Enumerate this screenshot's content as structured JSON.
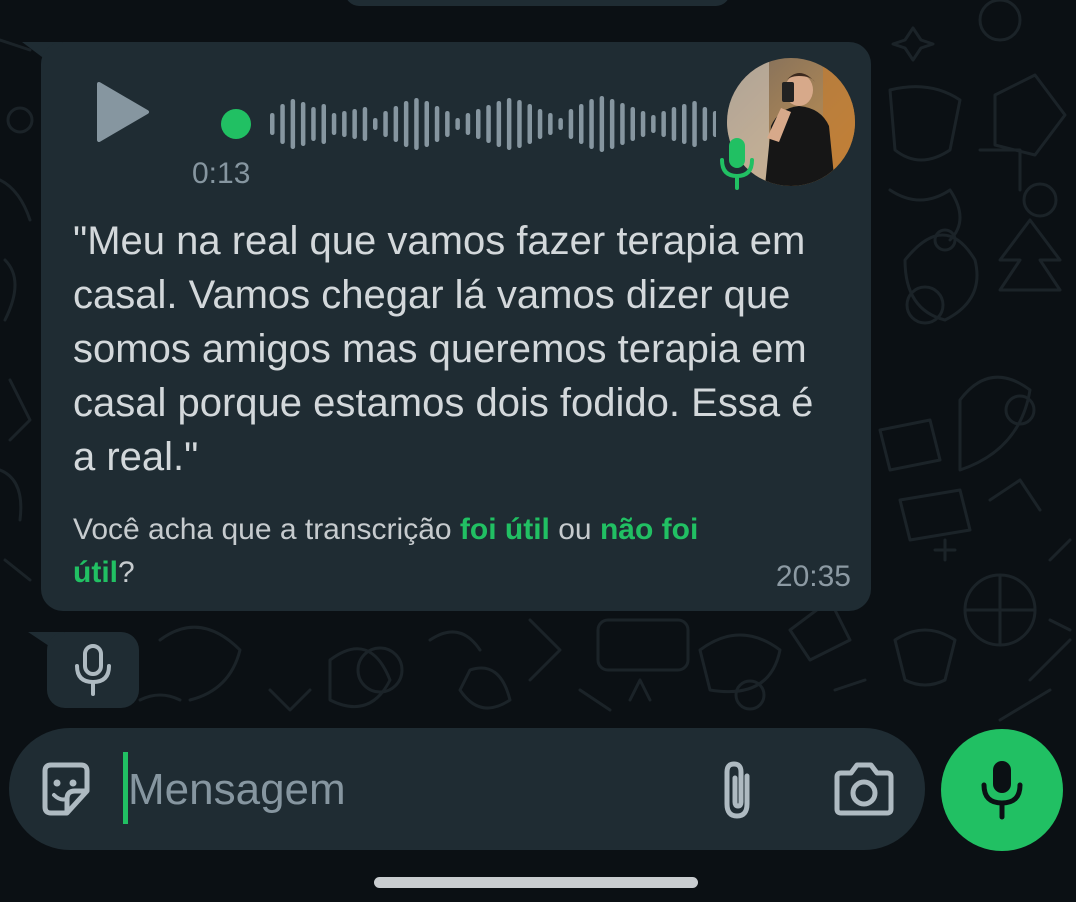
{
  "audio_message": {
    "duration": "0:13",
    "transcript": "\"Meu na real que vamos fazer terapia em casal. Vamos chegar lá vamos dizer que somos amigos mas queremos terapia em casal porque estamos dois fodido. Essa é a real.\"",
    "feedback": {
      "prefix": "Você acha que a transcrição ",
      "useful_link": "foi útil",
      "middle": " ou ",
      "not_useful_link": "não foi útil",
      "suffix": "?"
    },
    "time": "20:35",
    "icons": {
      "play": "play-icon",
      "mic": "mic-icon",
      "avatar": "contact-avatar"
    }
  },
  "voice_bubble": {
    "icon": "mic-icon"
  },
  "composer": {
    "placeholder": "Mensagem",
    "icons": [
      "sticker-icon",
      "attach-icon",
      "camera-icon",
      "mic-icon"
    ]
  },
  "colors": {
    "background": "#0b1014",
    "bubble": "#1f2c33",
    "accent": "#21c063",
    "text": "#d3d8db",
    "muted": "#8696a0"
  }
}
